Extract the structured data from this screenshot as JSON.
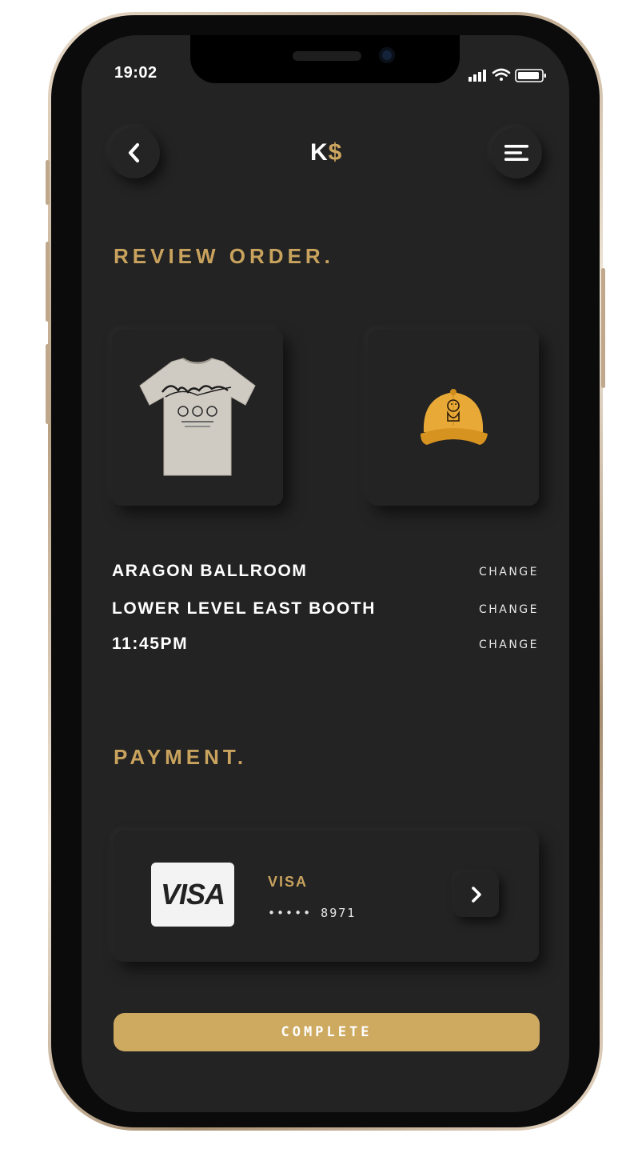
{
  "status_bar": {
    "time": "19:02",
    "icons": [
      "signal-icon",
      "wifi-icon",
      "battery-icon"
    ]
  },
  "header": {
    "back_icon": "chevron-left-icon",
    "logo_letter": "K",
    "logo_symbol": "$",
    "menu_icon": "menu-icon"
  },
  "review": {
    "title": "REVIEW ORDER.",
    "products": [
      {
        "image": "t-shirt-image"
      },
      {
        "image": "cap-image"
      }
    ],
    "details": [
      {
        "label": "ARAGON BALLROOM",
        "action": "CHANGE"
      },
      {
        "label": "LOWER LEVEL EAST BOOTH",
        "action": "CHANGE"
      },
      {
        "label": "11:45PM",
        "action": "CHANGE"
      }
    ]
  },
  "payment": {
    "title": "PAYMENT.",
    "card": {
      "logo_text": "VISA",
      "brand": "VISA",
      "number": "••••• 8971",
      "arrow_icon": "chevron-right-icon"
    }
  },
  "complete_button": {
    "label": "COMPLETE"
  },
  "colors": {
    "accent": "#c9a35d",
    "background": "#232323",
    "button": "#ceaa61"
  }
}
